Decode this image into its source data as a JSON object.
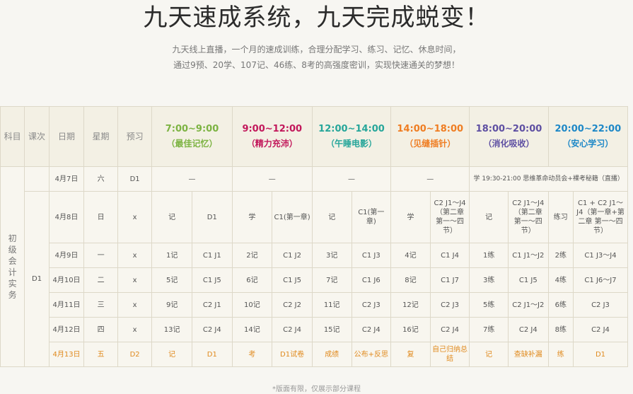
{
  "title": "九天速成系统，九天完成蜕变！",
  "subtitle": [
    "九天线上直播，一个月的速成训练，合理分配学习、练习、记忆、休息时间，",
    "通过9预、20学、107记、46练、8考的高强度密训，实现快速通关的梦想！"
  ],
  "header": {
    "subject": "科目",
    "lesson": "课次",
    "date": "日期",
    "weekday": "星期",
    "preview": "预习",
    "slots": [
      {
        "time": "7:00~9:00",
        "label": "（最佳记忆）",
        "color": "#7cb342"
      },
      {
        "time": "9:00~12:00",
        "label": "（精力充沛）",
        "color": "#c2185b"
      },
      {
        "time": "12:00~14:00",
        "label": "（午睡电影）",
        "color": "#26a69a"
      },
      {
        "time": "14:00~18:00",
        "label": "（见缝插针）",
        "color": "#ef7d22"
      },
      {
        "time": "18:00~20:00",
        "label": "（消化吸收）",
        "color": "#5e4fa2"
      },
      {
        "time": "20:00~22:00",
        "label": "（安心学习）",
        "color": "#1e88c7"
      }
    ]
  },
  "subject_name": "初级会计实务",
  "lesson_d1": "D1",
  "row_apr7": {
    "date": "4月7日",
    "weekday": "六",
    "preview": "D1",
    "s1": "—",
    "s2": "—",
    "s3": "—",
    "s4": "—",
    "evening": "学 19:30-21:00 思维革命动员会+裸考秘籍（直播）"
  },
  "row_apr8": {
    "date": "4月8日",
    "weekday": "日",
    "preview": "x",
    "cells": [
      "记",
      "D1",
      "学",
      "C1(第一章)",
      "记",
      "C1(第一章)",
      "学",
      "C2 J1～J4（第二章 第一～四节）",
      "记",
      "C2 J1～J4（第二章 第一～四节）",
      "练习",
      "C1 + C2 J1～J4（第一章+第二章 第一～四节）"
    ]
  },
  "rows": [
    {
      "date": "4月9日",
      "weekday": "一",
      "preview": "x",
      "cells": [
        "1记",
        "C1 J1",
        "2记",
        "C1 J2",
        "3记",
        "C1 J3",
        "4记",
        "C1 J4",
        "1练",
        "C1 J1～J2",
        "2练",
        "C1 J3～J4"
      ]
    },
    {
      "date": "4月10日",
      "weekday": "二",
      "preview": "x",
      "cells": [
        "5记",
        "C1 J5",
        "6记",
        "C1 J5",
        "7记",
        "C1 J6",
        "8记",
        "C1 J7",
        "3练",
        "C1 J5",
        "4练",
        "C1 J6～J7"
      ]
    },
    {
      "date": "4月11日",
      "weekday": "三",
      "preview": "x",
      "cells": [
        "9记",
        "C2 J1",
        "10记",
        "C2 J2",
        "11记",
        "C2 J3",
        "12记",
        "C2 J3",
        "5练",
        "C2 J1～J2",
        "6练",
        "C2 J3"
      ]
    },
    {
      "date": "4月12日",
      "weekday": "四",
      "preview": "x",
      "cells": [
        "13记",
        "C2 J4",
        "14记",
        "C2 J4",
        "15记",
        "C2 J4",
        "16记",
        "C2 J4",
        "7练",
        "C2 J4",
        "8练",
        "C2 J4"
      ]
    }
  ],
  "row_apr13": {
    "date": "4月13日",
    "weekday": "五",
    "preview": "D2",
    "cells": [
      "记",
      "D1",
      "考",
      "D1试卷",
      "成绩",
      "公布+反思",
      "复",
      "自己归纳总结",
      "记",
      "查缺补漏",
      "练",
      "D1"
    ]
  },
  "footnote": "*版面有限，仅展示部分课程"
}
